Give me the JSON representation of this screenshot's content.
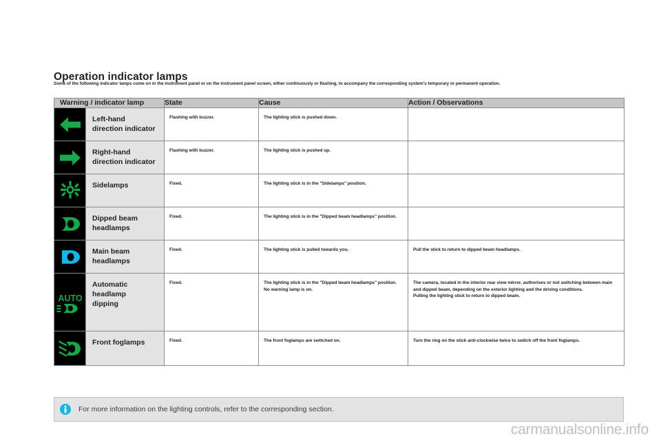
{
  "page": {
    "heading": "Operation indicator lamps",
    "subheading": "Some of the following indicator lamps come on in the instrument panel or on the instrument panel screen, either continuously or flashing, to accompany the corresponding system's temporary or permanent operation."
  },
  "table": {
    "columns": [
      {
        "key": "lamp",
        "label": "Warning / indicator lamp"
      },
      {
        "key": "state",
        "label": "State"
      },
      {
        "key": "cause",
        "label": "Cause"
      },
      {
        "key": "action",
        "label": "Action / Observations"
      }
    ],
    "rows": [
      {
        "icon": "left-arrow-icon",
        "icon_color": "#18a84a",
        "name": "Left-hand\ndirection indicator",
        "state": "Flashing with buzzer.",
        "cause": "The lighting stick is pushed down.",
        "action": ""
      },
      {
        "icon": "right-arrow-icon",
        "icon_color": "#18a84a",
        "name": "Right-hand\ndirection indicator",
        "state": "Flashing with buzzer.",
        "cause": "The lighting stick is pushed up.",
        "action": ""
      },
      {
        "icon": "sidelamps-icon",
        "icon_color": "#18a84a",
        "name": "Sidelamps",
        "state": "Fixed.",
        "cause": "The lighting stick is in the \"Sidelamps\" position.",
        "action": ""
      },
      {
        "icon": "dipped-beam-icon",
        "icon_color": "#18a84a",
        "name": "Dipped beam\nheadlamps",
        "state": "Fixed.",
        "cause": "The lighting stick is in the \"Dipped beam headlamps\" position.",
        "action": ""
      },
      {
        "icon": "main-beam-icon",
        "icon_color": "#18b4e8",
        "name": "Main beam\nheadlamps",
        "state": "Fixed.",
        "cause": "The lighting stick is pulled towards you.",
        "action": "Pull the stick to return to dipped beam headlamps."
      },
      {
        "icon": "auto-headlamp-dipping-icon",
        "icon_color": "#18a84a",
        "name": "Automatic\nheadlamp\ndipping",
        "state": "Fixed.",
        "cause": "The lighting stick is in the \"Dipped beam headlamps\" position.\nNo warning lamp is on.",
        "action": "The camera, located in the interior rear view mirror, authorises or not switching between main and dipped beam, depending on the exterior lighting and the driving conditions.\nPulling the lighting stick to return to dipped beam."
      },
      {
        "icon": "front-foglamps-icon",
        "icon_color": "#18a84a",
        "name": "Front foglamps",
        "state": "Fixed.",
        "cause": "The front foglamps are switched on.",
        "action": "Turn the ring on the stick anti-clockwise twice to switch off the front foglamps."
      }
    ]
  },
  "note": {
    "icon": "info-icon",
    "icon_color": "#1ab6e0",
    "text": "For more information on the lighting controls, refer to the corresponding section."
  },
  "watermark": {
    "text": "carmanualsonline.info"
  }
}
